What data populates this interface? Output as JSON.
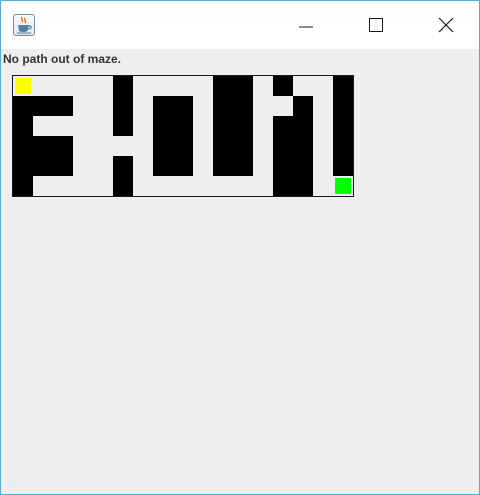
{
  "window": {
    "icon": "java-coffee-cup-icon",
    "controls": [
      "minimize-icon",
      "maximize-icon",
      "close-icon"
    ]
  },
  "status_text": "No path out of maze.",
  "maze": {
    "rows": 6,
    "cols": 17,
    "grid": [
      "S....#....##.#..#",
      "###..#.##.##..#.#",
      "#....#.##.##.##.#",
      "###....##.##.##.#",
      "###..#.##.##.##.#",
      "#....#.......##.G"
    ],
    "legend": {
      "wall": "#",
      "open": ".",
      "start": "S",
      "goal": "G"
    },
    "colors": {
      "wall": "#000000",
      "open": "#eeeeee",
      "start": "#ffff00",
      "goal": "#00ff00"
    }
  }
}
